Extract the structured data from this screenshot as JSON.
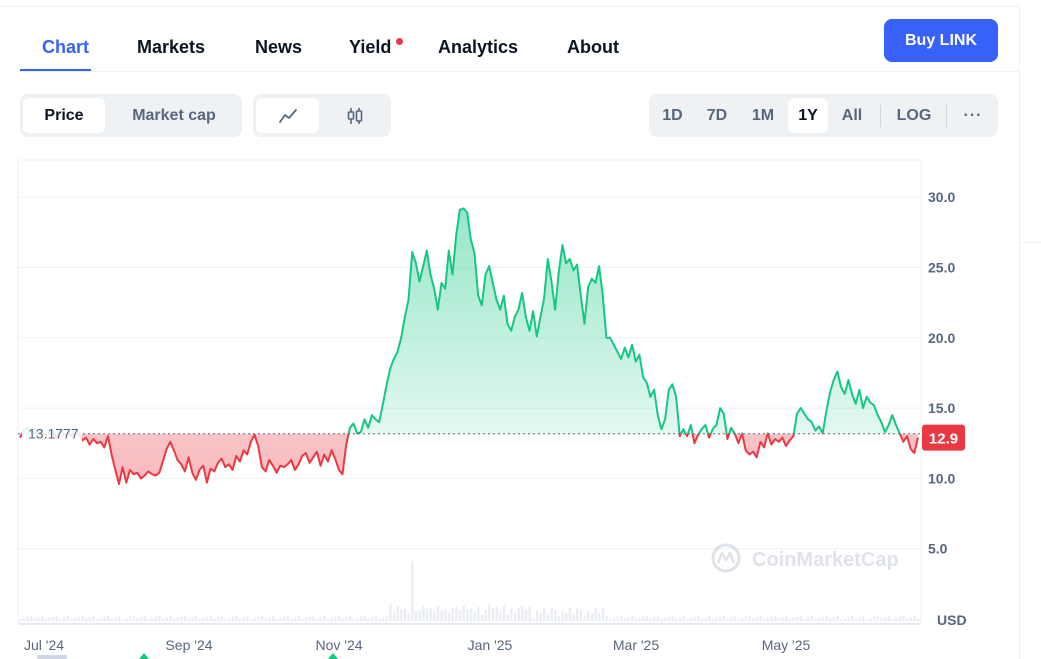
{
  "tabs": [
    {
      "label": "Chart",
      "active": true
    },
    {
      "label": "Markets"
    },
    {
      "label": "News"
    },
    {
      "label": "Yield",
      "has_notification_dot": true
    },
    {
      "label": "Analytics"
    },
    {
      "label": "About"
    }
  ],
  "buy_button": "Buy LINK",
  "view_toggle": {
    "options": [
      "Price",
      "Market cap"
    ],
    "selected": "Price"
  },
  "chart_type_toggle": {
    "options": [
      "line-chart-icon",
      "candlestick-icon"
    ],
    "selected": "line-chart-icon"
  },
  "time_ranges": {
    "options": [
      "1D",
      "7D",
      "1M",
      "1Y",
      "All"
    ],
    "selected": "1Y"
  },
  "log_label": "LOG",
  "more_label": "···",
  "colors": {
    "accent": "#3861fb",
    "up": "#16c784",
    "down": "#ea3943",
    "notification": "#ea3943"
  },
  "chart_data": {
    "type": "area",
    "y_unit": "USD",
    "y_ticks": [
      "5.0",
      "10.0",
      "15.0",
      "20.0",
      "25.0",
      "30.0"
    ],
    "x_ticks": [
      "Jul '24",
      "Sep '24",
      "Nov '24",
      "Jan '25",
      "Mar '25",
      "May '25"
    ],
    "ylim": [
      0,
      32.5
    ],
    "baseline": 13.1777,
    "baseline_label": "13.1777",
    "current_price_label": "12.9",
    "watermark": "CoinMarketCap",
    "grid": true,
    "series": [
      {
        "values": [
          12.9,
          13.4,
          13.6,
          13.3,
          13.5,
          13.2,
          13.4,
          13.1,
          13.2,
          13.3,
          12.9,
          13.5,
          13.1,
          13.3,
          13.0,
          13.6,
          13.2,
          12.7,
          12.9,
          12.4,
          12.8,
          12.5,
          12.6,
          12.2,
          13.0,
          11.7,
          10.6,
          9.6,
          10.8,
          9.7,
          10.6,
          10.3,
          10.4,
          10.0,
          10.2,
          10.5,
          10.3,
          10.2,
          10.4,
          11.2,
          12.1,
          12.6,
          12.0,
          11.3,
          11.0,
          10.5,
          11.5,
          10.4,
          9.9,
          10.6,
          10.9,
          9.7,
          10.7,
          10.5,
          11.1,
          11.4,
          10.8,
          11.0,
          10.6,
          11.6,
          11.2,
          12.0,
          11.7,
          12.6,
          13.1,
          12.3,
          10.8,
          10.5,
          11.3,
          10.9,
          10.4,
          10.9,
          10.8,
          11.0,
          11.3,
          10.6,
          11.0,
          11.6,
          11.8,
          11.1,
          11.5,
          11.9,
          10.9,
          11.7,
          11.2,
          12.0,
          11.4,
          10.6,
          10.3,
          12.4,
          13.6,
          13.9,
          13.2,
          13.3,
          14.2,
          13.6,
          14.5,
          14.2,
          14.0,
          15.3,
          16.6,
          17.8,
          18.5,
          19.0,
          20.0,
          21.5,
          22.7,
          26.1,
          25.3,
          24.0,
          25.1,
          26.2,
          24.5,
          23.5,
          22.0,
          23.9,
          23.5,
          26.2,
          24.5,
          27.3,
          29.1,
          29.2,
          28.9,
          27.0,
          26.0,
          23.0,
          22.3,
          24.5,
          25.1,
          23.9,
          22.7,
          22.0,
          23.0,
          21.0,
          20.5,
          21.5,
          22.0,
          23.2,
          21.5,
          20.5,
          21.9,
          20.1,
          21.5,
          22.8,
          25.6,
          24.0,
          22.0,
          24.7,
          26.6,
          25.3,
          25.6,
          24.8,
          25.2,
          23.0,
          21.0,
          23.6,
          24.2,
          23.9,
          25.1,
          23.0,
          20.0,
          20.0,
          19.5,
          19.0,
          18.5,
          19.3,
          18.6,
          19.5,
          18.3,
          18.8,
          17.2,
          16.8,
          15.8,
          16.3,
          14.5,
          13.5,
          14.2,
          16.3,
          16.7,
          15.8,
          13.0,
          13.5,
          13.0,
          13.8,
          12.5,
          13.1,
          13.5,
          13.8,
          12.9,
          13.5,
          13.8,
          15.0,
          14.6,
          12.8,
          13.6,
          13.2,
          12.5,
          13.2,
          12.0,
          11.7,
          11.9,
          11.5,
          12.6,
          12.2,
          13.2,
          12.4,
          12.8,
          12.6,
          12.9,
          12.3,
          12.7,
          13.0,
          14.6,
          15.0,
          14.6,
          14.2,
          14.0,
          13.4,
          13.7,
          13.2,
          14.8,
          16.1,
          17.0,
          17.6,
          16.5,
          16.0,
          17.0,
          16.0,
          15.3,
          16.3,
          15.0,
          15.8,
          15.4,
          15.2,
          14.5,
          14.0,
          13.3,
          13.8,
          14.5,
          13.8,
          13.2,
          12.6,
          13.0,
          12.1,
          11.8,
          12.9
        ]
      }
    ]
  }
}
